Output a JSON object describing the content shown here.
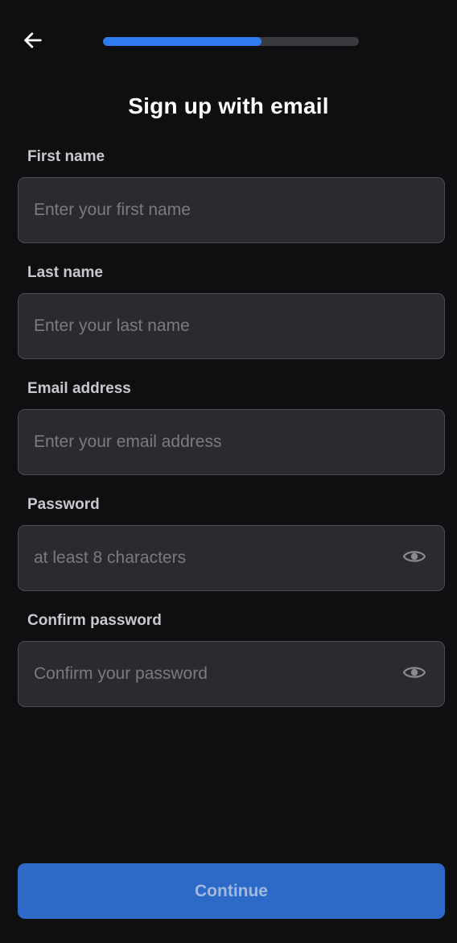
{
  "header": {
    "back_icon": "arrow-left-icon",
    "progress_fraction": 0.62,
    "accent_color": "#2f7bf0"
  },
  "title": "Sign up with email",
  "fields": [
    {
      "label": "First name",
      "placeholder": "Enter your first name",
      "value": ""
    },
    {
      "label": "Last name",
      "placeholder": "Enter your last name",
      "value": ""
    },
    {
      "label": "Email address",
      "placeholder": "Enter your email address",
      "value": ""
    },
    {
      "label": "Password",
      "placeholder": "at least 8 characters",
      "value": "",
      "toggle_icon": "eye-icon"
    },
    {
      "label": "Confirm password",
      "placeholder": "Confirm your password",
      "value": "",
      "toggle_icon": "eye-icon"
    }
  ],
  "continue_label": "Continue"
}
